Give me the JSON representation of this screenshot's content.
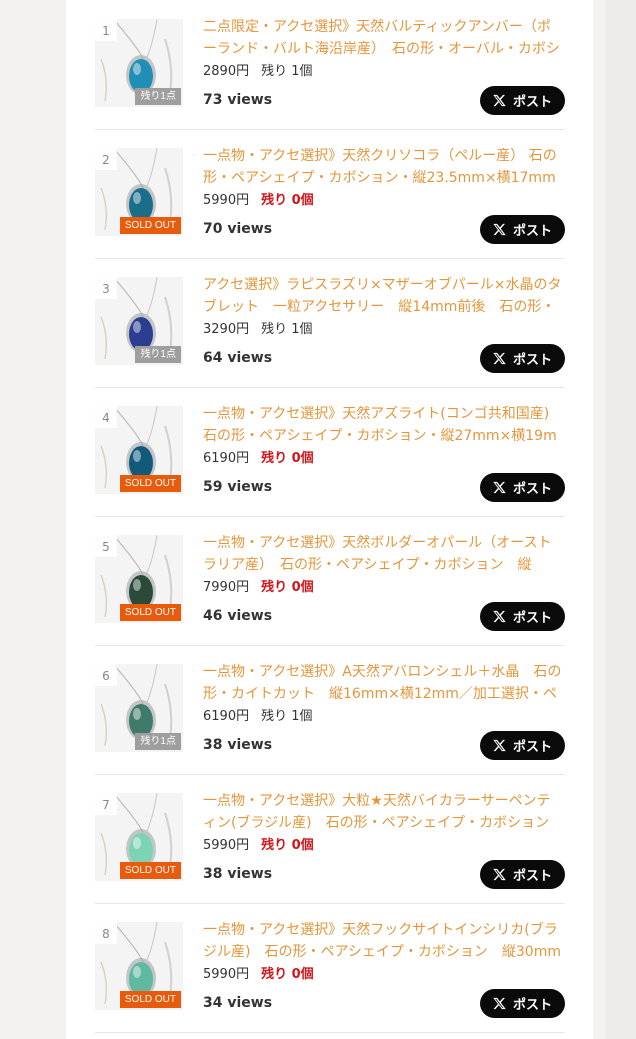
{
  "items": [
    {
      "rank": "1",
      "title": "二点限定・アクセ選択》天然バルティックアンバー（ポーランド・バルト海沿岸産）　石の形・オーバル・カボション",
      "price": "2890円",
      "stock": "残り 1個",
      "stock_status": "available",
      "badge": "残り1点",
      "views": "73 views",
      "post_label": "ポスト",
      "stone_color": "#1f8fb5"
    },
    {
      "rank": "2",
      "title": "一点物・アクセ選択》天然クリソコラ（ペルー産） 石の形・ペアシェイプ・カボション・縦23.5mm×横17mm /",
      "price": "5990円",
      "stock": "残り 0個",
      "stock_status": "out",
      "badge": "SOLD OUT",
      "views": "70 views",
      "post_label": "ポスト",
      "stone_color": "#1a6e8a"
    },
    {
      "rank": "3",
      "title": "アクセ選択》ラピスラズリ×マザーオブパール×水晶のタブレット　一粒アクセサリー　縦14mm前後　石の形・",
      "price": "3290円",
      "stock": "残り 1個",
      "stock_status": "available",
      "badge": "残り1点",
      "views": "64 views",
      "post_label": "ポスト",
      "stone_color": "#2a3d8f"
    },
    {
      "rank": "4",
      "title": "一点物・アクセ選択》天然アズライト(コンゴ共和国産) 石の形・ペアシェイプ・カボション・縦27mm×横19m",
      "price": "6190円",
      "stock": "残り 0個",
      "stock_status": "out",
      "badge": "SOLD OUT",
      "views": "59 views",
      "post_label": "ポスト",
      "stone_color": "#125a7a"
    },
    {
      "rank": "5",
      "title": "一点物・アクセ選択》天然ボルダーオパール（オーストラリア産）　石の形・ペアシェイプ・カボション　縦",
      "price": "7990円",
      "stock": "残り 0個",
      "stock_status": "out",
      "badge": "SOLD OUT",
      "views": "46 views",
      "post_label": "ポスト",
      "stone_color": "#2b4a3a"
    },
    {
      "rank": "6",
      "title": "一点物・アクセ選択》A天然アバロンシェル＋水晶　石の形・カイトカット　縦16mm×横12mm／加工選択・ペ",
      "price": "6190円",
      "stock": "残り 1個",
      "stock_status": "available",
      "badge": "残り1点",
      "views": "38 views",
      "post_label": "ポスト",
      "stone_color": "#3f7a6a"
    },
    {
      "rank": "7",
      "title": "一点物・アクセ選択》大粒★天然バイカラーサーペンティン(ブラジル産)　石の形・ペアシェイプ・カボション",
      "price": "5990円",
      "stock": "残り 0個",
      "stock_status": "out",
      "badge": "SOLD OUT",
      "views": "38 views",
      "post_label": "ポスト",
      "stone_color": "#7fd3b5"
    },
    {
      "rank": "8",
      "title": "一点物・アクセ選択》天然フックサイトインシリカ(ブラジル産)　石の形・ペアシェイプ・カボション　縦30mm",
      "price": "5990円",
      "stock": "残り 0個",
      "stock_status": "out",
      "badge": "SOLD OUT",
      "views": "34 views",
      "post_label": "ポスト",
      "stone_color": "#5fb8a0"
    }
  ]
}
